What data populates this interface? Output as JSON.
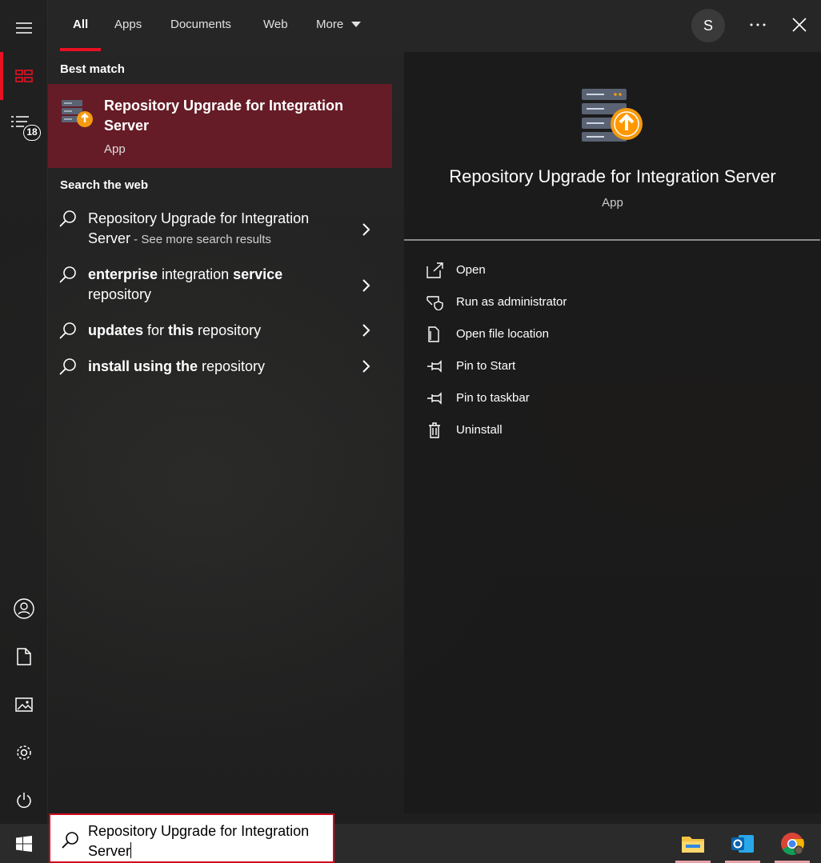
{
  "tabs": [
    {
      "label": "All",
      "active": true
    },
    {
      "label": "Apps"
    },
    {
      "label": "Documents"
    },
    {
      "label": "Web"
    },
    {
      "label": "More"
    }
  ],
  "user_initial": "S",
  "rail": {
    "badge_count": "18"
  },
  "best_match": {
    "heading": "Best match",
    "title": "Repository Upgrade for Integration Server",
    "subtitle": "App"
  },
  "search_web": {
    "heading": "Search the web",
    "items": [
      {
        "line1": "Repository Upgrade for Integration",
        "line2": "Server",
        "suffix": " - See more search results"
      },
      {
        "bold1": "enterprise",
        "plain1": " integration ",
        "bold2": "service",
        "line2": "repository"
      },
      {
        "bold1": "updates",
        "plain1": " for ",
        "bold2": "this",
        "plain2": " repository"
      },
      {
        "bold1": "install using the",
        "plain1": " repository"
      }
    ]
  },
  "detail": {
    "title": "Repository Upgrade for Integration Server",
    "subtitle": "App",
    "actions": [
      {
        "label": "Open",
        "icon": "open-icon"
      },
      {
        "label": "Run as administrator",
        "icon": "shield-icon"
      },
      {
        "label": "Open file location",
        "icon": "file-location-icon"
      },
      {
        "label": "Pin to Start",
        "icon": "pin-icon"
      },
      {
        "label": "Pin to taskbar",
        "icon": "pin-icon"
      },
      {
        "label": "Uninstall",
        "icon": "trash-icon"
      }
    ]
  },
  "search_box": {
    "query": "Repository Upgrade for Integration Server"
  },
  "colors": {
    "accent": "#e81123",
    "best_match_bg": "#661c27"
  }
}
